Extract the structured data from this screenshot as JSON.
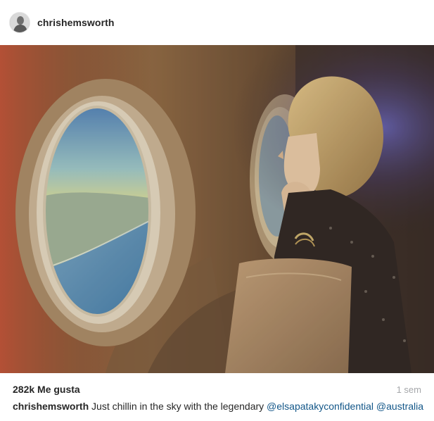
{
  "header": {
    "username": "chrishemsworth",
    "avatar_icon": "profile-avatar-icon"
  },
  "photo": {
    "subject": "airplane-window-photo"
  },
  "footer": {
    "likes": "282k Me gusta",
    "timestamp": "1 sem"
  },
  "caption": {
    "username": "chrishemsworth",
    "text": "Just chillin in the sky with the legendary",
    "mentions": [
      "@elsapatakyconfidential",
      "@australia"
    ]
  },
  "colors": {
    "text": "#262626",
    "mention": "#125688",
    "timestamp": "#a5a7aa"
  }
}
